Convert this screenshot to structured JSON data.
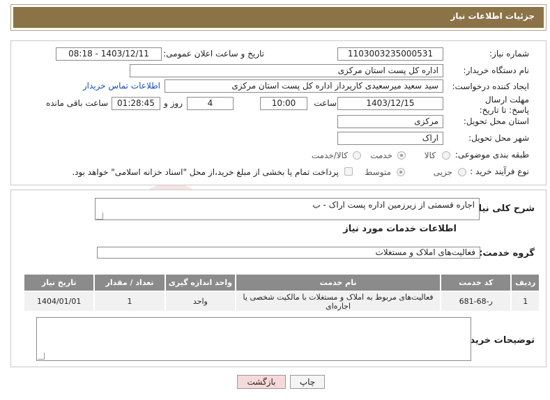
{
  "header": {
    "title": "جزئیات اطلاعات نیاز"
  },
  "form": {
    "need_number_label": "شماره نیاز:",
    "need_number": "1103003235000531",
    "announce_label": "تاریخ و ساعت اعلان عمومی:",
    "announce_value": "1403/12/11 - 08:18",
    "buyer_org_label": "نام دستگاه خریدار:",
    "buyer_org": "اداره کل پست استان مرکزی",
    "creator_label": "ایجاد کننده درخواست:",
    "creator": "سید سعید میرسعیدی کارپرداز اداره کل پست استان مرکزی",
    "contact_link": "اطلاعات تماس خریدار",
    "deadline_label": "مهلت ارسال پاسخ: تا تاریخ:",
    "deadline_date": "1403/12/15",
    "time_label": "ساعت",
    "deadline_time": "10:00",
    "days_value": "4",
    "days_label": "روز و",
    "remaining_time": "01:28:45",
    "remaining_label": "ساعت باقی مانده",
    "province_label": "استان محل تحویل:",
    "province": "مرکزی",
    "city_label": "شهر محل تحویل:",
    "city": "اراک",
    "category_label": "طبقه بندی موضوعی:",
    "category_options": [
      "کالا",
      "خدمت",
      "کالا/خدمت"
    ],
    "category_selected": "خدمت",
    "process_label": "نوع فرآیند خرید :",
    "process_options": [
      "جزیی",
      "متوسط"
    ],
    "process_selected": "متوسط",
    "payment_note": "پرداخت تمام یا بخشی از مبلغ خرید،از محل \"اسناد خزانه اسلامی\" خواهد بود."
  },
  "details": {
    "summary_label": "شرح کلی نیاز:",
    "summary_text": "اجاره قسمتی از زیرزمین اداره پست اراک - ب",
    "services_title": "اطلاعات خدمات مورد نیاز",
    "group_label": "گروه خدمت:",
    "group_value": "فعالیت‌های  املاک و مستغلات",
    "table": {
      "headers": [
        "ردیف",
        "کد خدمت",
        "نام خدمت",
        "واحد اندازه گیری",
        "تعداد / مقدار",
        "تاریخ نیاز"
      ],
      "rows": [
        [
          "1",
          "ر-68-681",
          "فعالیت‌های مربوط به املاک و مستغلات با مالکیت شخصی یا اجاره‌ای",
          "واحد",
          "1",
          "1404/01/01"
        ]
      ]
    },
    "buyer_notes_label": "توضیحات خریدار:",
    "buyer_notes": ""
  },
  "buttons": {
    "print": "چاپ",
    "back": "بازگشت"
  },
  "colors": {
    "header_bg": "#8b7347",
    "table_header_bg": "#8b8b8b",
    "back_button_bg": "#f7d9d9",
    "link": "#1a4fb4"
  }
}
